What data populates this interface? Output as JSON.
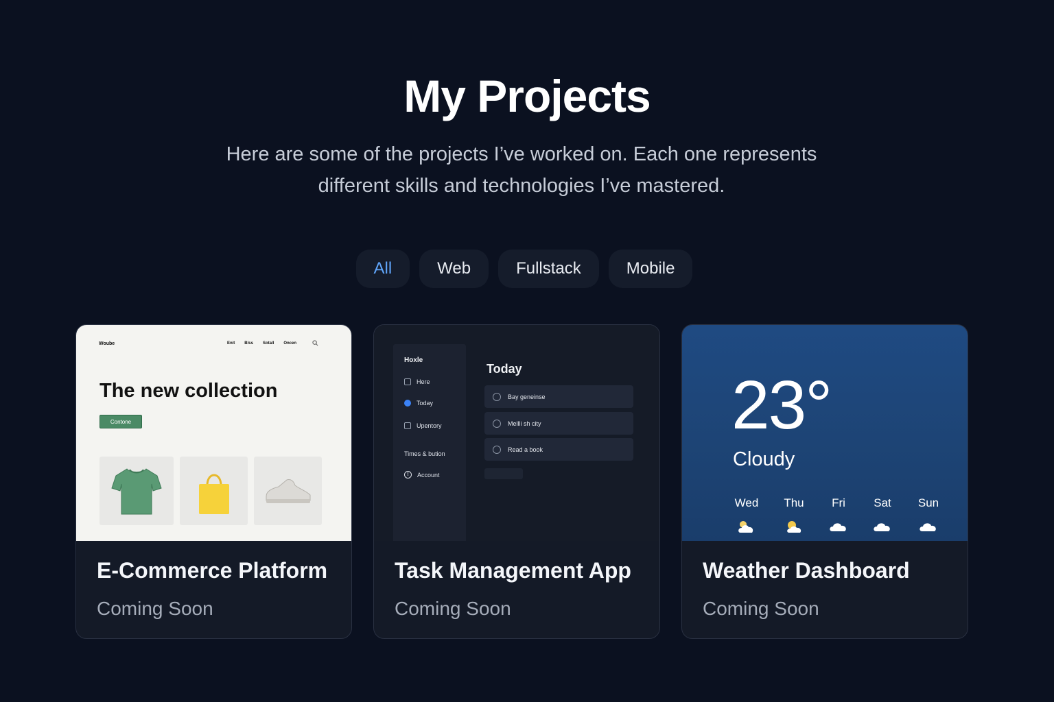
{
  "header": {
    "title": "My Projects",
    "subtitle_line1": "Here are some of the projects I’ve worked on. Each one represents",
    "subtitle_line2": "different skills and technologies I’ve mastered."
  },
  "filters": [
    {
      "label": "All",
      "active": true
    },
    {
      "label": "Web",
      "active": false
    },
    {
      "label": "Fullstack",
      "active": false
    },
    {
      "label": "Mobile",
      "active": false
    }
  ],
  "accent_color": "#60a5fa",
  "projects": [
    {
      "title": "E-Commerce Platform",
      "status": "Coming Soon",
      "preview": {
        "logo": "Woube",
        "nav": [
          "Enit",
          "Blss",
          "Sotall",
          "Oncen"
        ],
        "hero": "The new collection",
        "cta": "Contone",
        "products": [
          "t-shirt-icon",
          "tote-bag-icon",
          "sneaker-icon"
        ]
      }
    },
    {
      "title": "Task Management App",
      "status": "Coming Soon",
      "preview": {
        "brand": "Hoxle",
        "sidebar": [
          "Here",
          "Today",
          "Upentory"
        ],
        "section": "Times & bution",
        "account": "Account",
        "heading": "Today",
        "tasks": [
          "Bay geneinse",
          "Mellli sh city",
          "Read a book"
        ]
      }
    },
    {
      "title": "Weather Dashboard",
      "status": "Coming Soon",
      "preview": {
        "temperature": "23°",
        "condition": "Cloudy",
        "forecast": [
          {
            "day": "Wed",
            "icon": "partly-cloudy-icon"
          },
          {
            "day": "Thu",
            "icon": "sun-cloud-icon"
          },
          {
            "day": "Fri",
            "icon": "cloud-icon"
          },
          {
            "day": "Sat",
            "icon": "cloud-icon"
          },
          {
            "day": "Sun",
            "icon": "cloud-icon"
          }
        ]
      }
    }
  ]
}
